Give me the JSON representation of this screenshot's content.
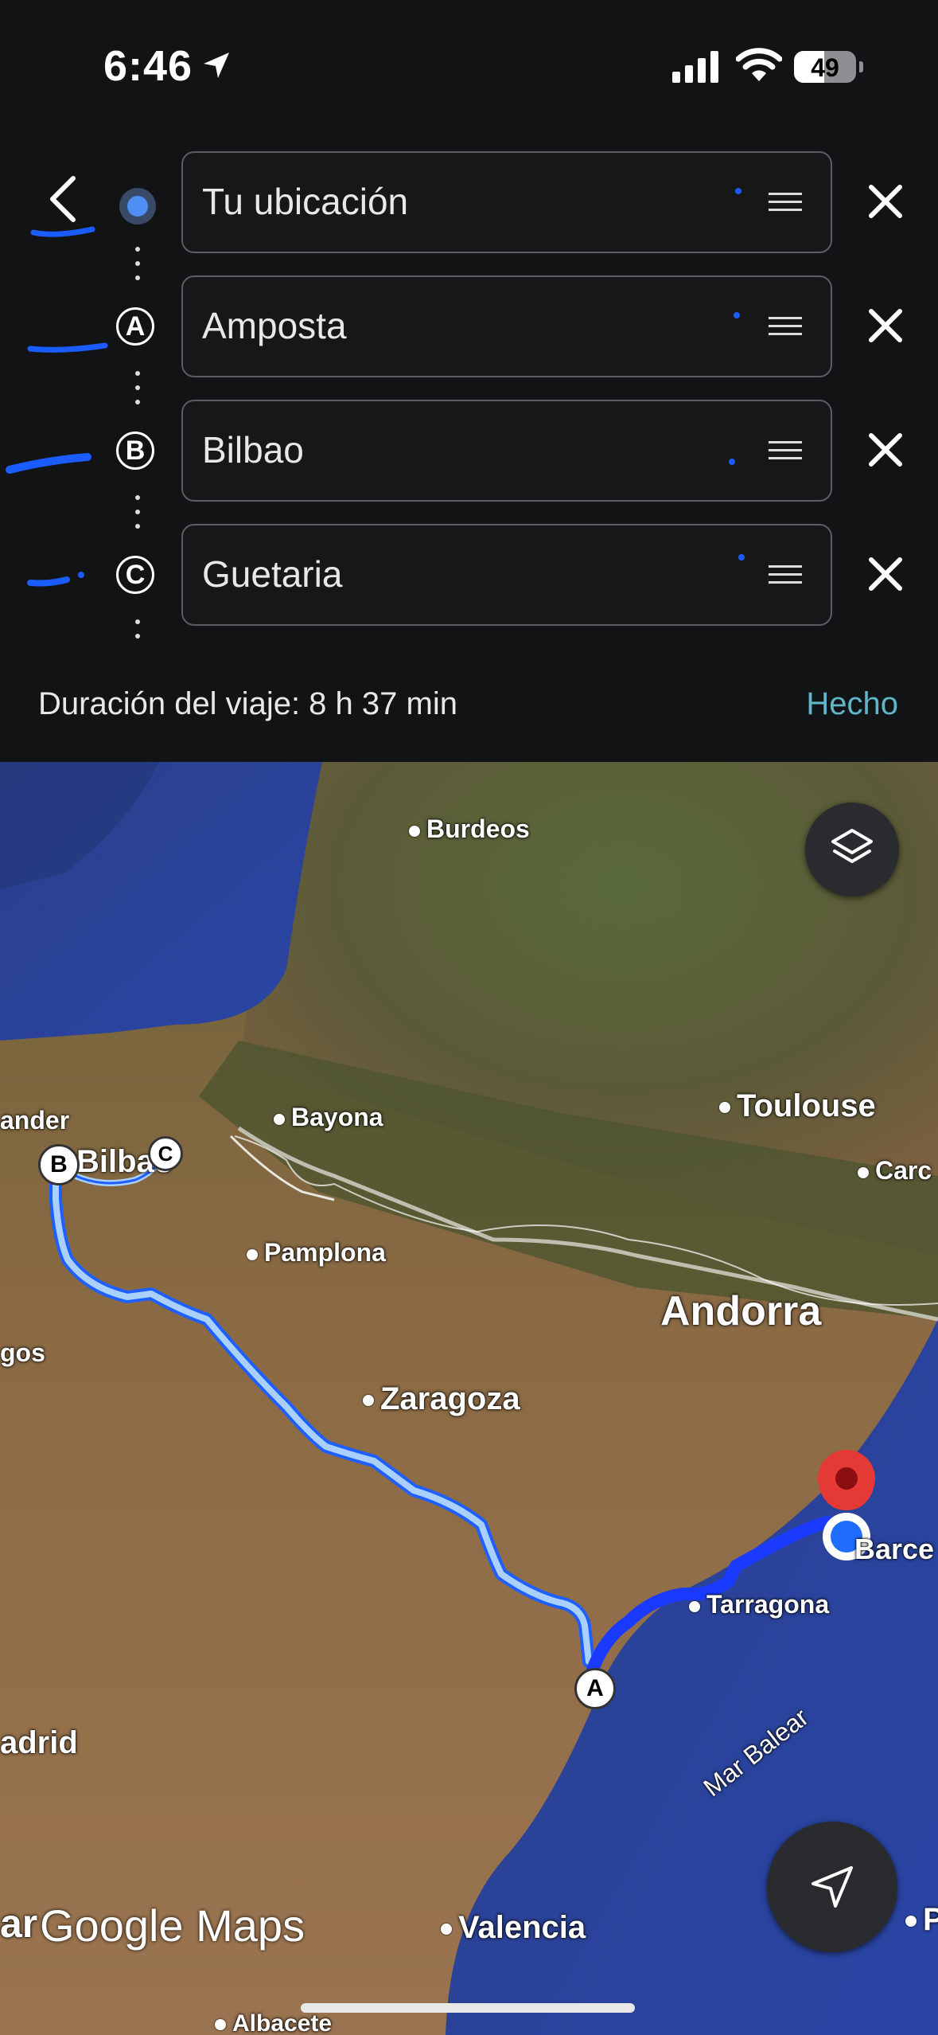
{
  "status_bar": {
    "time": "6:46",
    "battery": "49"
  },
  "route": {
    "stops": [
      {
        "marker": "",
        "value": "Tu ubicación"
      },
      {
        "marker": "A",
        "value": "Amposta"
      },
      {
        "marker": "B",
        "value": "Bilbao"
      },
      {
        "marker": "C",
        "value": "Guetaria"
      }
    ],
    "duration": "Duración del viaje: 8 h 37 min",
    "done_label": "Hecho"
  },
  "map": {
    "labels": {
      "burdeos": "Burdeos",
      "toulouse": "Toulouse",
      "carc": "Carc",
      "bayona": "Bayona",
      "ander": "ander",
      "bilbao": "Bilbao",
      "pamplona": "Pamplona",
      "andorra": "Andorra",
      "gos": "gos",
      "zaragoza": "Zaragoza",
      "barce": "Barce",
      "tarragona": "Tarragona",
      "adrid": "adrid",
      "mar_balear": "Mar Balear",
      "valencia": "Valencia",
      "albacete": "Albacete",
      "ar": "ar",
      "p": "P"
    },
    "route_markers": {
      "a": "A",
      "b": "B"
    },
    "watermark": "Google Maps"
  },
  "colors": {
    "accent": "#5fb6c9",
    "route_active": "#1a4cff",
    "route_alt": "#8ec0f5",
    "origin_dot": "#4f8ff5",
    "pin": "#e53935"
  },
  "icons": [
    "back-chevron-icon",
    "drag-handle-icon",
    "close-icon",
    "layers-icon",
    "navigation-arrow-icon",
    "location-arrow-icon",
    "signal-icon",
    "wifi-icon",
    "battery-icon"
  ]
}
